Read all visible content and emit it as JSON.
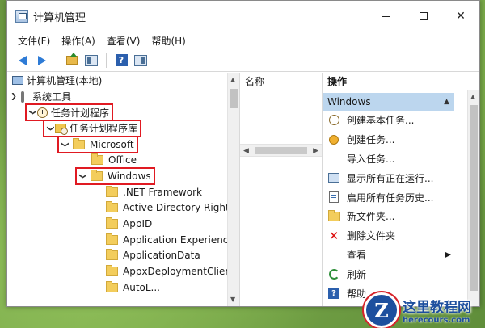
{
  "window": {
    "title": "计算机管理"
  },
  "menubar": {
    "items": [
      "文件(F)",
      "操作(A)",
      "查看(V)",
      "帮助(H)"
    ]
  },
  "toolbar": {
    "icons": [
      "back-arrow",
      "forward-arrow",
      "folder-up",
      "show-hide-tree",
      "help",
      "show-hide-action-pane"
    ]
  },
  "tree": {
    "root": "计算机管理(本地)",
    "system_tools": "系统工具",
    "task_scheduler": "任务计划程序",
    "task_library": "任务计划程序库",
    "microsoft": "Microsoft",
    "office": "Office",
    "windows": "Windows",
    "windows_children": [
      ".NET Framework",
      "Active Directory Rights",
      "AppID",
      "Application Experience",
      "ApplicationData",
      "AppxDeploymentClien",
      "AutoL..."
    ]
  },
  "name_pane": {
    "header": "名称"
  },
  "actions": {
    "header": "操作",
    "group": "Windows",
    "items": [
      {
        "label": "创建基本任务...",
        "icon": "basic-task-icon"
      },
      {
        "label": "创建任务...",
        "icon": "task-icon"
      },
      {
        "label": "导入任务...",
        "icon": "none"
      },
      {
        "label": "显示所有正在运行...",
        "icon": "display-running-icon"
      },
      {
        "label": "启用所有任务历史...",
        "icon": "history-icon"
      },
      {
        "label": "新文件夹...",
        "icon": "folder-icon"
      },
      {
        "label": "删除文件夹",
        "icon": "delete-icon"
      },
      {
        "label": "查看",
        "icon": "none"
      },
      {
        "label": "刷新",
        "icon": "refresh-icon"
      },
      {
        "label": "帮助",
        "icon": "help-icon"
      }
    ]
  },
  "watermark": {
    "logo_letter": "Z",
    "cn": "这里教程网",
    "en": "herecours.com"
  },
  "colors": {
    "highlight_box": "#e01a22",
    "action_group_bg": "#bcd6ee",
    "desktop_bg": "#6f9a44"
  }
}
